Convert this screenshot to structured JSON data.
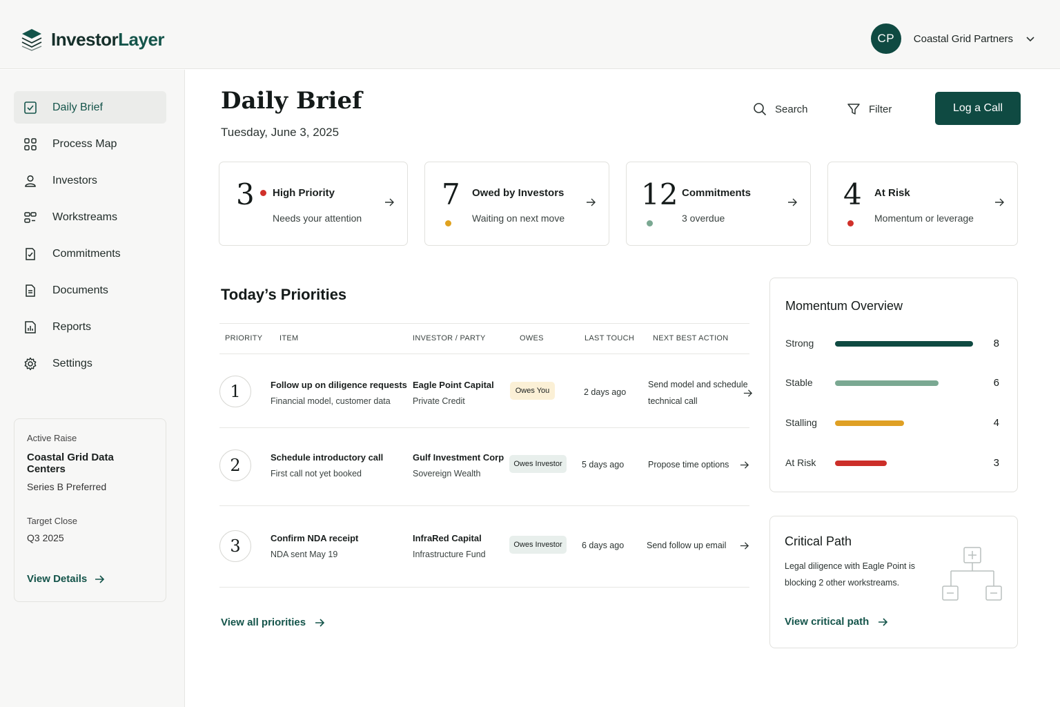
{
  "app": {
    "brand_main": "Investor",
    "brand_accent": "Layer",
    "account_initials": "CP",
    "account_name": "Coastal Grid Partners"
  },
  "sidebar": {
    "items": [
      {
        "label": "Daily Brief",
        "icon": "checkbox-icon",
        "active": true
      },
      {
        "label": "Process Map",
        "icon": "grid-icon"
      },
      {
        "label": "Investors",
        "icon": "user-icon"
      },
      {
        "label": "Workstreams",
        "icon": "workstreams-icon"
      },
      {
        "label": "Commitments",
        "icon": "commitment-doc-icon"
      },
      {
        "label": "Documents",
        "icon": "document-icon"
      },
      {
        "label": "Reports",
        "icon": "report-icon"
      },
      {
        "label": "Settings",
        "icon": "gear-icon"
      }
    ],
    "raise": {
      "label": "Active Raise",
      "name": "Coastal Grid Data Centers",
      "series": "Series B Preferred",
      "target_close_label": "Target Close",
      "target_close": "Q3 2025",
      "link": "View Details"
    }
  },
  "header": {
    "title": "Daily Brief",
    "date": "Tuesday, June 3, 2025",
    "search_label": "Search",
    "filter_label": "Filter",
    "primary_button": "Log a Call"
  },
  "stats": [
    {
      "number": "3",
      "title": "High Priority",
      "subtitle": "Needs your attention",
      "dot_color": "#d0302a"
    },
    {
      "number": "7",
      "title": "Owed by Investors",
      "subtitle": "Waiting on next move",
      "dot_color": "#e0a21f"
    },
    {
      "number": "12",
      "title": "Commitments",
      "subtitle": "3 overdue",
      "dot_color": "#7aa892"
    },
    {
      "number": "4",
      "title": "At Risk",
      "subtitle": "Momentum or leverage",
      "dot_color": "#d0302a"
    }
  ],
  "priorities": {
    "title": "Today’s Priorities",
    "columns": [
      "PRIORITY",
      "ITEM",
      "INVESTOR / PARTY",
      "OWES",
      "LAST TOUCH",
      "NEXT BEST ACTION"
    ],
    "rows": [
      {
        "rank": "1",
        "item": "Follow up on diligence requests",
        "item_sub": "Financial model, customer data",
        "party": "Eagle Point Capital",
        "party_sub": "Private Credit",
        "owes": "Owes You",
        "last_touch": "2 days ago",
        "action_line1": "Send model and schedule",
        "action_line2": "technical call"
      },
      {
        "rank": "2",
        "item": "Schedule introductory call",
        "item_sub": "First call not yet booked",
        "party": "Gulf Investment Corp",
        "party_sub": "Sovereign Wealth",
        "owes": "Owes Investor",
        "last_touch": "5 days ago",
        "action_line1": "Propose time options",
        "action_line2": ""
      },
      {
        "rank": "3",
        "item": "Confirm NDA receipt",
        "item_sub": "NDA sent May 19",
        "party": "InfraRed Capital",
        "party_sub": "Infrastructure Fund",
        "owes": "Owes Investor",
        "last_touch": "6 days ago",
        "action_line1": "Send follow up email",
        "action_line2": ""
      }
    ],
    "view_all": "View all priorities"
  },
  "momentum": {
    "title": "Momentum Overview",
    "max": 8,
    "rows": [
      {
        "label": "Strong",
        "value": 8,
        "color": "#0f4a42"
      },
      {
        "label": "Stable",
        "value": 6,
        "color": "#7aa892"
      },
      {
        "label": "Stalling",
        "value": 4,
        "color": "#dfa024"
      },
      {
        "label": "At Risk",
        "value": 3,
        "color": "#cc2f29"
      }
    ]
  },
  "critical_path": {
    "title": "Critical Path",
    "text_line1": "Legal diligence with Eagle Point is",
    "text_line2": "blocking 2 other workstreams.",
    "link": "View critical path"
  }
}
